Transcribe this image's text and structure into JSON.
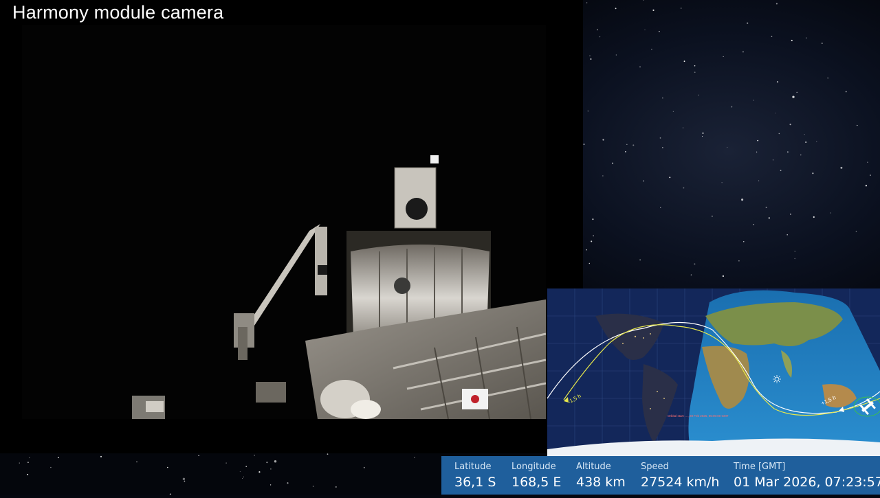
{
  "camera": {
    "title": "Harmony module camera"
  },
  "map": {
    "orbit_markers": {
      "past_label": "-1,5 h",
      "future_label": "+1,5 h"
    },
    "orbit_note": "Orbital start: ..., 28 Feb 2026, 05:00:00 GMT",
    "icons": [
      "sun-icon",
      "iss-icon"
    ],
    "colors": {
      "past_track": "#e8e84a",
      "future_track": "#ffffff",
      "ocean_day": "#1e7fbf",
      "ocean_night": "#0f2250"
    }
  },
  "telemetry": {
    "latitude": {
      "label": "Latitude",
      "value": "36,1 S"
    },
    "longitude": {
      "label": "Longitude",
      "value": "168,5 E"
    },
    "altitude": {
      "label": "Altitude",
      "value": "438 km"
    },
    "speed": {
      "label": "Speed",
      "value": "27524 km/h"
    },
    "time": {
      "label": "Time [GMT]",
      "value": "01 Mar 2026, 07:23:57"
    }
  }
}
